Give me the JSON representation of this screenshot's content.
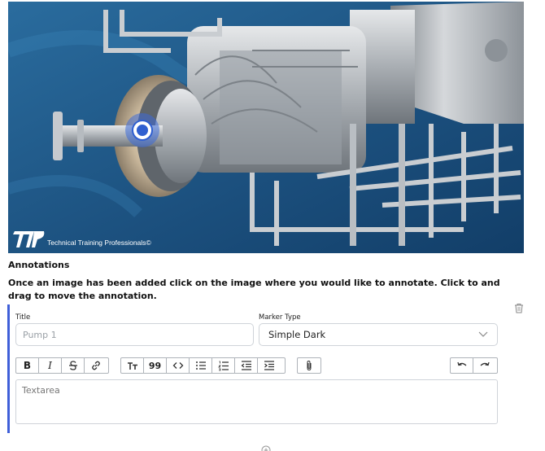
{
  "hero": {
    "logo_text": "Technical Training Professionals",
    "copyright_symbol": "©"
  },
  "annotations": {
    "heading": "Annotations",
    "instructions": "Once an image has been added click on the image where you would like to annotate. Click to and drag to move the annotation."
  },
  "form": {
    "title_label": "Title",
    "title_placeholder": "Pump 1",
    "marker_type_label": "Marker Type",
    "marker_type_value": "Simple Dark",
    "textarea_placeholder": "Textarea"
  },
  "toolbar": {
    "bold": "B",
    "italic": "I",
    "heading": "T",
    "quote": "99"
  },
  "colors": {
    "accent": "#3f5fd8",
    "marker": "#2f5fd0"
  }
}
